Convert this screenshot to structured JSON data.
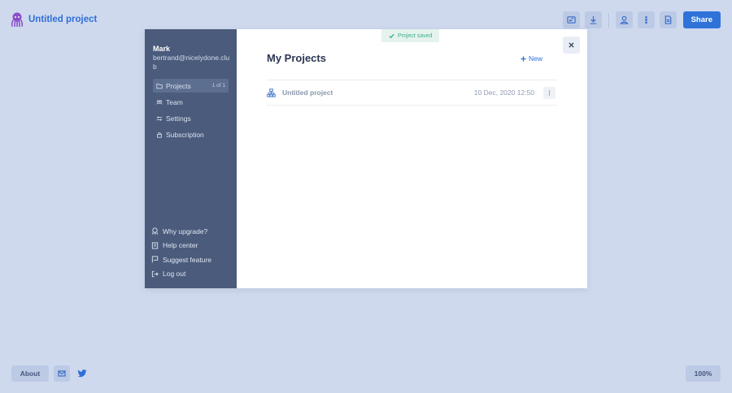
{
  "header": {
    "project_title": "Untitled project",
    "share_label": "Share",
    "icons": [
      "export-image-icon",
      "download-icon",
      "user-icon",
      "more-vertical-icon",
      "document-icon"
    ]
  },
  "modal": {
    "user": {
      "name": "Mark",
      "email": "bertrand@nicelydone.club"
    },
    "nav": [
      {
        "label": "Projects",
        "icon": "folder-icon",
        "count": "1 of 1",
        "active": true
      },
      {
        "label": "Team",
        "icon": "team-icon"
      },
      {
        "label": "Settings",
        "icon": "sliders-icon"
      },
      {
        "label": "Subscription",
        "icon": "lock-icon"
      }
    ],
    "bottom_nav": [
      {
        "label": "Why upgrade?",
        "icon": "mascot-icon"
      },
      {
        "label": "Help center",
        "icon": "book-icon"
      },
      {
        "label": "Suggest feature",
        "icon": "flag-icon"
      },
      {
        "label": "Log out",
        "icon": "logout-icon"
      }
    ],
    "saved_badge": "Project saved",
    "title": "My Projects",
    "new_label": "New",
    "projects": [
      {
        "name": "Untitled project",
        "date": "10 Dec, 2020 12:50"
      }
    ]
  },
  "footer": {
    "about_label": "About",
    "zoom_label": "100%"
  },
  "colors": {
    "background": "#cfd9ee",
    "accent": "#2f73d9",
    "sidebar": "#4a5b7c",
    "saved_badge": "#3fae8a"
  }
}
